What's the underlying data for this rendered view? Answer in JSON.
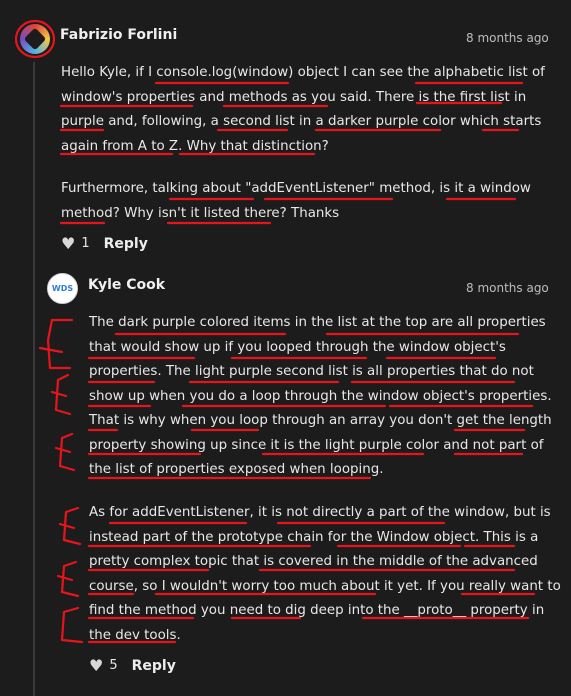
{
  "comment": {
    "author": "Fabrizio Forlini",
    "time": "8 months ago",
    "paragraphs": [
      [
        "Hello Kyle, if I console.log(window) object I can see the alphabetic list of",
        "window's properties and methods as you said. There is the first list in",
        "purple and, following, a second list in a darker purple color which starts",
        "again from A to Z. Why that distinction?"
      ],
      [
        "Furthermore, talking about \"addEventListener\" method, is it a window",
        "method? Why isn't it listed there? Thanks"
      ]
    ],
    "likes": "1",
    "reply_label": "Reply"
  },
  "reply": {
    "author": "Kyle Cook",
    "avatar_text": "WDS",
    "time": "8 months ago",
    "paragraphs": [
      [
        "The dark purple colored items in the list at the top are all properties",
        "that would show up if you looped through the window object's",
        "properties. The light purple second list is all properties that do not",
        "show up when you do a loop through the window object's properties.",
        "That is why when you loop through an array you don't get the length",
        "property showing up since it is the light purple color and not part of",
        "the list of properties exposed when looping."
      ],
      [
        "As for addEventListener, it is not directly a part of the window, but is",
        "instead part of the prototype chain for the Window object. This is a",
        "pretty complex topic that is covered in the middle of the advanced",
        "course, so I wouldn't worry too much about it yet. If you really want to",
        "find the method you need to dig deep into the __proto__ property in",
        "the dev tools."
      ]
    ],
    "likes": "5",
    "reply_label": "Reply"
  },
  "icons": {
    "like": "heart-icon"
  },
  "colors": {
    "background": "#1c1c1c",
    "annotation": "#e8141c"
  }
}
